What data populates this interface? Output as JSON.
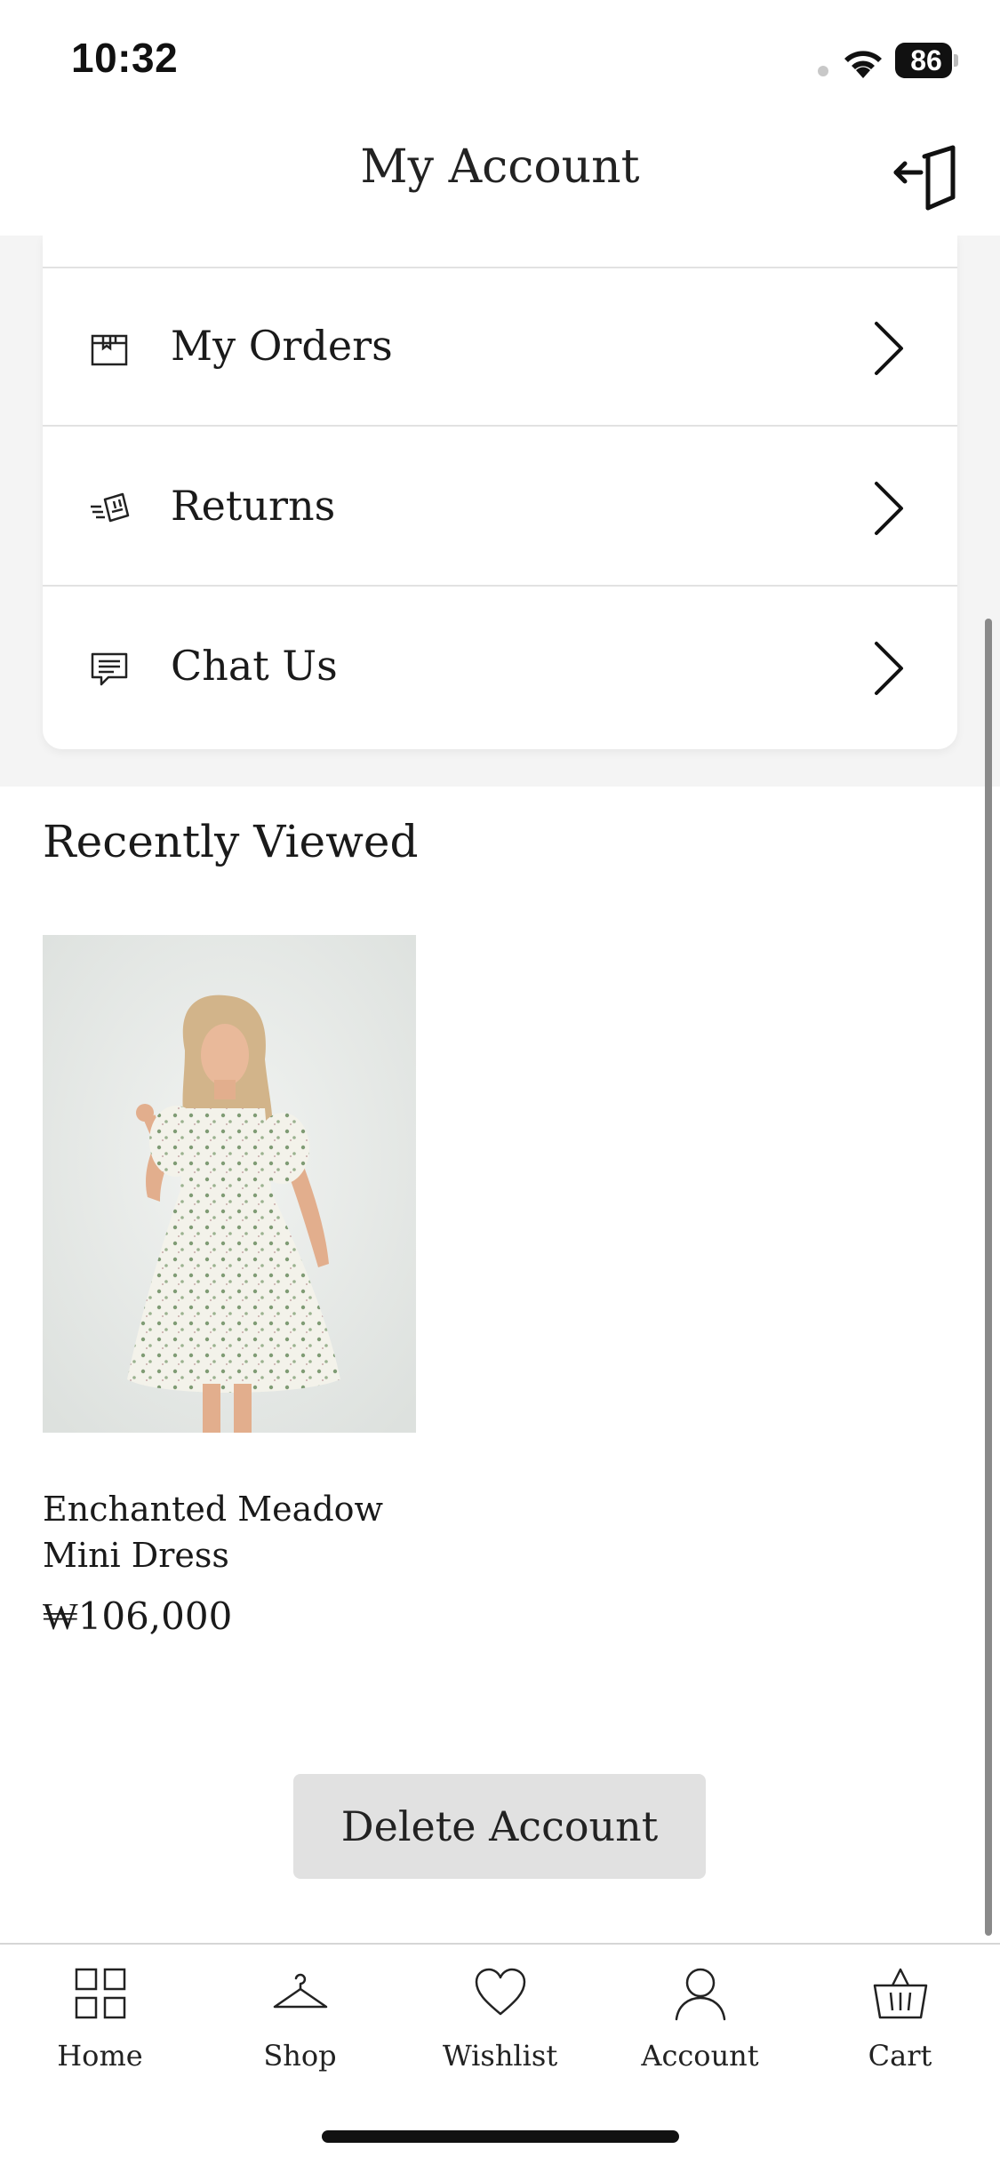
{
  "status_bar": {
    "time": "10:32",
    "battery": "86"
  },
  "header": {
    "title": "My Account"
  },
  "menu": {
    "items": [
      {
        "label": "My Orders",
        "icon": "box-icon"
      },
      {
        "label": "Returns",
        "icon": "return-package-icon"
      },
      {
        "label": "Chat Us",
        "icon": "chat-icon"
      }
    ]
  },
  "recently_viewed": {
    "title": "Recently Viewed",
    "products": [
      {
        "name": "Enchanted Meadow Mini Dress",
        "price": "₩106,000"
      }
    ]
  },
  "delete_account": {
    "label": "Delete Account"
  },
  "tab_bar": {
    "tabs": [
      {
        "label": "Home",
        "icon": "grid-icon"
      },
      {
        "label": "Shop",
        "icon": "hanger-icon"
      },
      {
        "label": "Wishlist",
        "icon": "heart-icon"
      },
      {
        "label": "Account",
        "icon": "user-icon"
      },
      {
        "label": "Cart",
        "icon": "basket-icon"
      }
    ]
  }
}
